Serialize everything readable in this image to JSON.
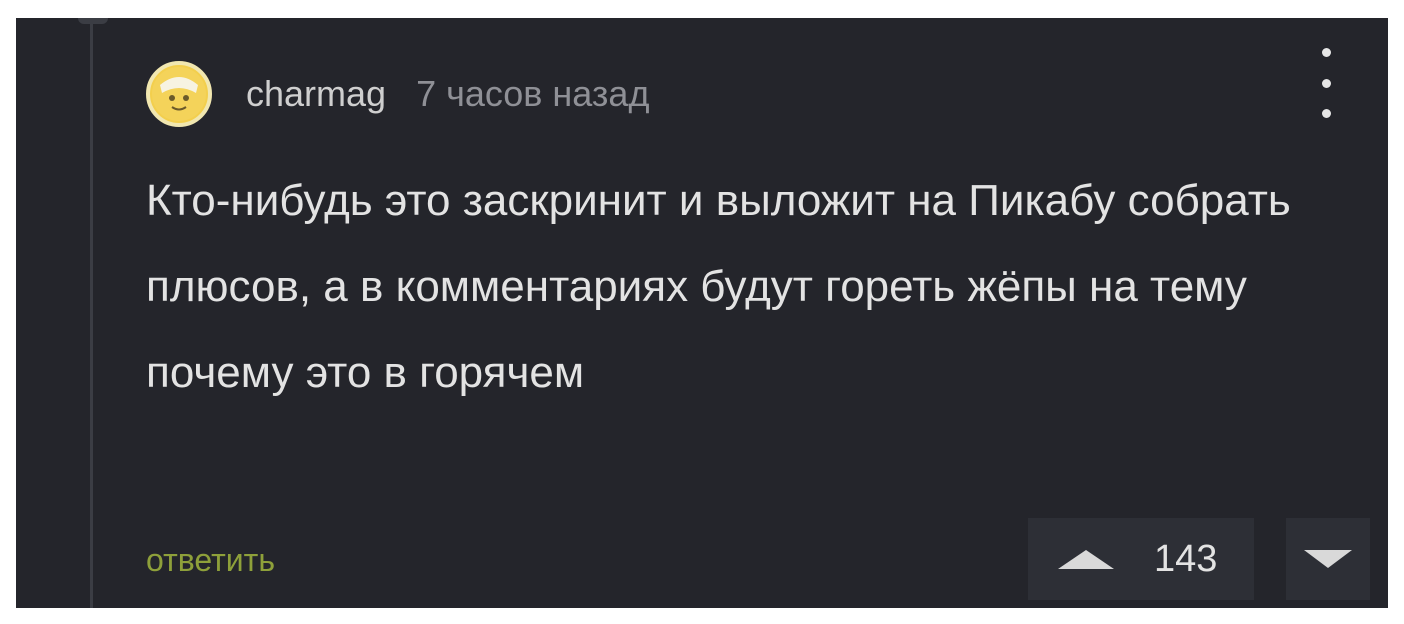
{
  "comment": {
    "author": "charmag",
    "time": "7 часов назад",
    "text": "Кто-нибудь это заскринит и выложит на Пикабу собрать плюсов, а в комментариях будут гореть жёпы на тему почему это в горячем",
    "reply_label": "ответить",
    "rating": "143",
    "icons": {
      "avatar": "avatar-icon",
      "menu": "more-vertical-icon",
      "upvote": "triangle-up-icon",
      "downvote": "triangle-down-icon"
    }
  },
  "colors": {
    "card_background": "#24252b",
    "reply_link": "#8ea03a",
    "text": "#e3e3e3",
    "meta": "#8f9096"
  }
}
